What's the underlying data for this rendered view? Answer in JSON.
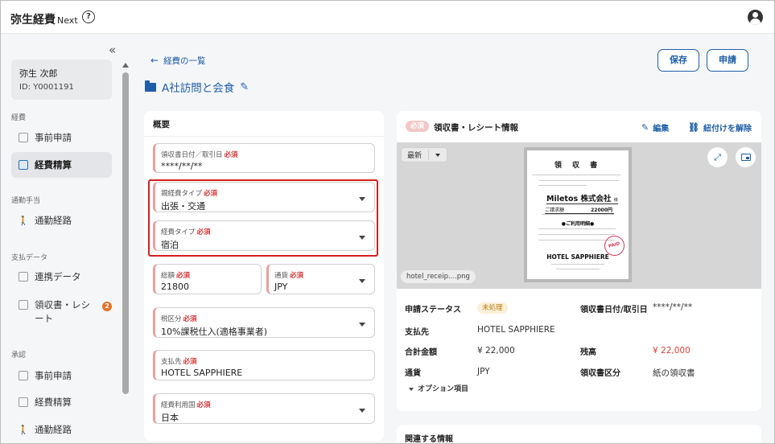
{
  "header": {
    "app_name": "弥生経費",
    "app_name_sub": "Next",
    "help_glyph": "?"
  },
  "sidebar": {
    "collapse_glyph": "«",
    "user": {
      "name": "弥生 次郎",
      "id": "ID: Y0001191"
    },
    "sections": [
      {
        "label": "経費",
        "items": [
          {
            "label": "事前申請"
          },
          {
            "label": "経費精算",
            "active": true
          }
        ]
      },
      {
        "label": "通勤手当",
        "items": [
          {
            "label": "通勤経路"
          }
        ]
      },
      {
        "label": "支払データ",
        "items": [
          {
            "label": "連携データ"
          },
          {
            "label": "領収書・レシート",
            "badge": "2"
          }
        ]
      },
      {
        "label": "承認",
        "items": [
          {
            "label": "事前申請"
          },
          {
            "label": "経費精算"
          },
          {
            "label": "通勤経路"
          }
        ]
      }
    ]
  },
  "main": {
    "back_link": "経費の一覧",
    "back_glyph": "←",
    "title": "A社訪問と会食",
    "save_label": "保存",
    "apply_label": "申請"
  },
  "summary": {
    "title": "概要",
    "required_mark": "必須",
    "fields": {
      "receipt_date": {
        "label": "領収書日付／取引日",
        "value": "****/**/**"
      },
      "expense_type_parent": {
        "label": "親経費タイプ",
        "value": "出張・交通"
      },
      "expense_type": {
        "label": "経費タイプ",
        "value": "宿泊"
      },
      "amount": {
        "label": "総額",
        "value": "21800"
      },
      "currency": {
        "label": "通貨",
        "value": "JPY"
      },
      "tax_category": {
        "label": "税区分",
        "value": "10%課税仕入(適格事業者)"
      },
      "payee": {
        "label": "支払先",
        "value": "HOTEL SAPPHIERE"
      },
      "country": {
        "label": "経費利用国",
        "value": "日本"
      }
    }
  },
  "receipt_panel": {
    "required_badge": "必須",
    "title": "領収書・レシート情報",
    "edit_label": "編集",
    "unlink_label": "紐付けを解除",
    "version_label": "最新",
    "file_name": "hotel_receip....png",
    "receipt_image": {
      "heading": "領 収 書",
      "company": "Miletos 株式会社",
      "company_suffix": "様",
      "amount_label": "ご請求額",
      "amount": "22000円",
      "detail_heading": "●ご利用明細●",
      "hotel": "HOTEL SAPPHIERE",
      "stamp": "PAID"
    },
    "rows": {
      "status": {
        "label": "申請ステータス",
        "value": "未処理"
      },
      "receipt_date": {
        "label": "領収書日付/取引日",
        "value": "****/**/**"
      },
      "payee": {
        "label": "支払先",
        "value": "HOTEL SAPPHIERE"
      },
      "total": {
        "label": "合計金額",
        "value": "¥ 22,000"
      },
      "balance": {
        "label": "残高",
        "value": "¥ 22,000"
      },
      "currency": {
        "label": "通貨",
        "value": "JPY"
      },
      "receipt_type": {
        "label": "領収書区分",
        "value": "紙の領収書"
      }
    },
    "option_label": "オプション項目",
    "colors": {
      "balance": "#d9453a",
      "accent": "#1f5fa8",
      "highlight": "#d81e1e"
    }
  },
  "related": {
    "title": "関連する情報"
  }
}
